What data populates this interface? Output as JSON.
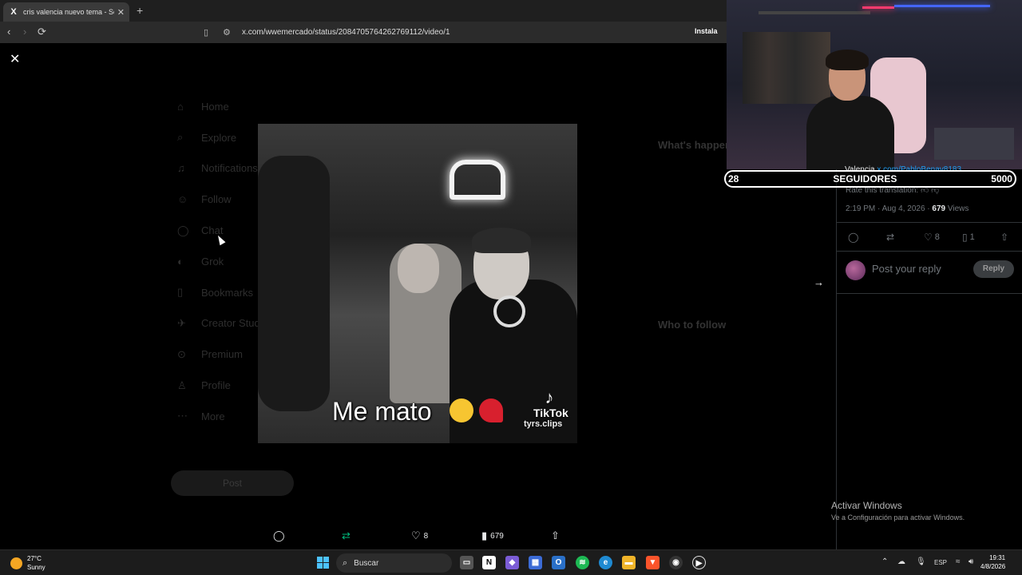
{
  "browser": {
    "tab_title": "cris valencia nuevo tema - Se",
    "url": "x.com/wwemercado/status/2084705764262769112/video/1",
    "install_label": "Instala"
  },
  "background_nav": [
    "Home",
    "Explore",
    "Notifications",
    "Follow",
    "Chat",
    "Grok",
    "Bookmarks",
    "Creator Studio",
    "Premium",
    "Profile",
    "More"
  ],
  "background_post": "Post",
  "background_right": {
    "whats_happening": "What's happening",
    "who_to_follow": "Who to follow"
  },
  "video": {
    "caption": "Me mato",
    "tiktok_brand": "TikTok",
    "tiktok_handle": "tyrs.clips"
  },
  "actions": {
    "likes": "8",
    "views": "679"
  },
  "reply_panel": {
    "rate_translation": "Rate this translation:",
    "time": "2:19 PM · Aug 4, 2026 · ",
    "views_count": "679",
    "views_label": " Views",
    "likes": "8",
    "bookmarks": "1",
    "reply_placeholder": "Post your reply",
    "reply_button": "Reply"
  },
  "sub_goal": {
    "current": "28",
    "label": "SEGUIDORES",
    "target": "5000",
    "name": "Valencia",
    "link": "x.com/PabloBenav8183..."
  },
  "activate_windows": {
    "title": "Activar Windows",
    "subtitle": "Ve a Configuración para activar Windows."
  },
  "taskbar": {
    "temp": "27°C",
    "condition": "Sunny",
    "search": "Buscar",
    "lang": "ESP",
    "time": "19:31",
    "date": "4/8/2026"
  }
}
